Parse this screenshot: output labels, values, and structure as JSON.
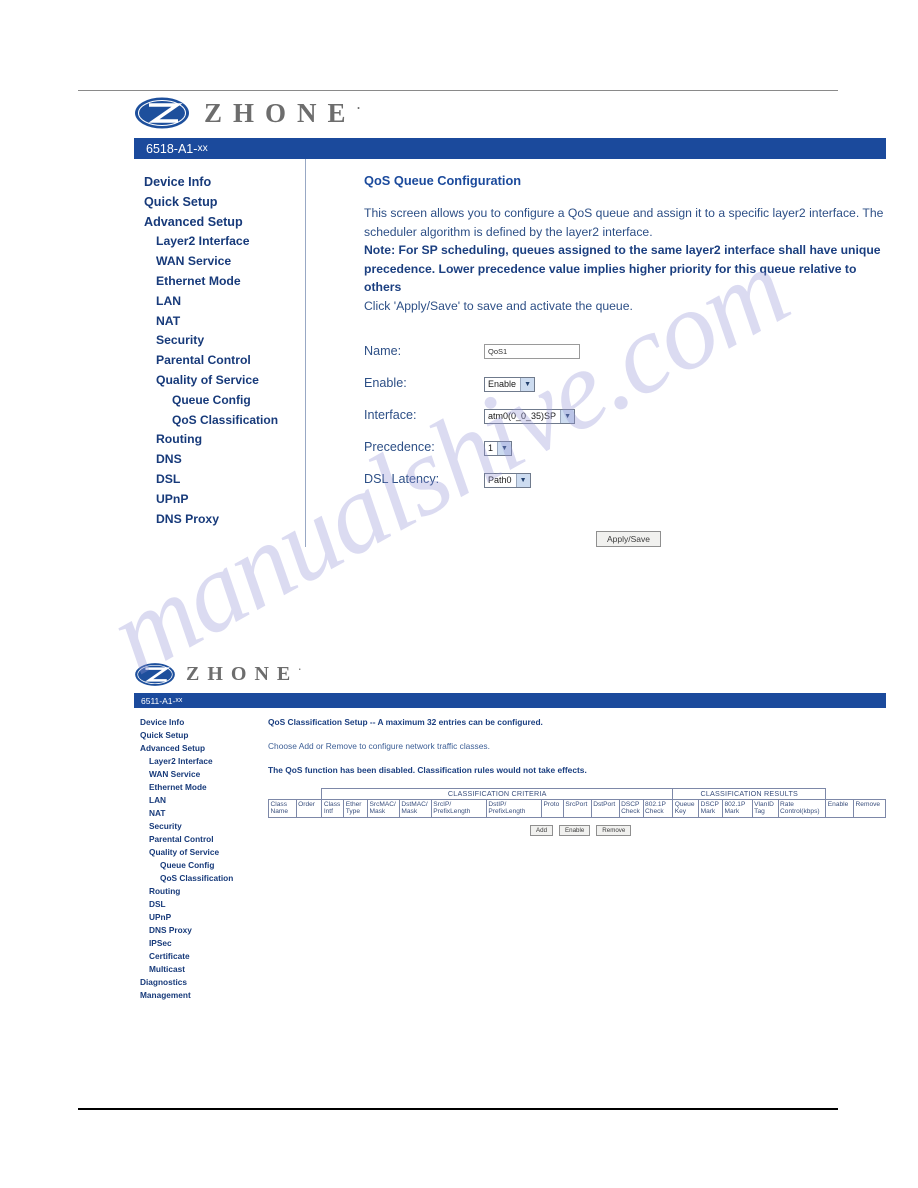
{
  "watermark": {
    "text": "manualshive.com"
  },
  "brand": {
    "wordmark": "ZHONE",
    "tm": "·"
  },
  "screenshot1": {
    "titlebar": {
      "model": "6518-A1-",
      "suffix": "xx"
    },
    "sidebar": {
      "items": [
        {
          "label": "Device Info",
          "level": 1
        },
        {
          "label": "Quick Setup",
          "level": 1
        },
        {
          "label": "Advanced Setup",
          "level": 1
        },
        {
          "label": "Layer2 Interface",
          "level": 2
        },
        {
          "label": "WAN Service",
          "level": 2
        },
        {
          "label": "Ethernet Mode",
          "level": 2
        },
        {
          "label": "LAN",
          "level": 2
        },
        {
          "label": "NAT",
          "level": 2
        },
        {
          "label": "Security",
          "level": 2
        },
        {
          "label": "Parental Control",
          "level": 2
        },
        {
          "label": "Quality of Service",
          "level": 2
        },
        {
          "label": "Queue Config",
          "level": 3
        },
        {
          "label": "QoS Classification",
          "level": 3
        },
        {
          "label": "Routing",
          "level": 2
        },
        {
          "label": "DNS",
          "level": 2
        },
        {
          "label": "DSL",
          "level": 2
        },
        {
          "label": "UPnP",
          "level": 2
        },
        {
          "label": "DNS Proxy",
          "level": 2
        }
      ]
    },
    "content": {
      "heading": "QoS Queue Configuration",
      "intro_line1": "This screen allows you to configure a QoS queue and assign it to a specific layer2 interface. The",
      "intro_line2": "scheduler algorithm is defined by the layer2 interface.",
      "note_label": "Note",
      "note_line1": ": For SP scheduling, queues assigned to the same layer2 interface shall have unique",
      "note_line2": "precedence. Lower precedence value implies higher priority for this queue relative to others",
      "intro_line3": "Click 'Apply/Save' to save and activate the queue.",
      "fields": [
        {
          "label": "Name:",
          "type": "text",
          "value": "QoS1"
        },
        {
          "label": "Enable:",
          "type": "select",
          "value": "Enable"
        },
        {
          "label": "Interface:",
          "type": "select",
          "value": "atm0(0_0_35)SP"
        },
        {
          "label": "Precedence:",
          "type": "select",
          "value": "1"
        },
        {
          "label": "DSL Latency:",
          "type": "select",
          "value": "Path0"
        }
      ],
      "apply_button": "Apply/Save"
    }
  },
  "screenshot2": {
    "titlebar": {
      "model": "6511-A1-",
      "suffix": "xx"
    },
    "sidebar": {
      "items": [
        {
          "label": "Device Info",
          "level": 1
        },
        {
          "label": "Quick Setup",
          "level": 1
        },
        {
          "label": "Advanced Setup",
          "level": 1
        },
        {
          "label": "Layer2 Interface",
          "level": 2
        },
        {
          "label": "WAN Service",
          "level": 2
        },
        {
          "label": "Ethernet Mode",
          "level": 2
        },
        {
          "label": "LAN",
          "level": 2
        },
        {
          "label": "NAT",
          "level": 2
        },
        {
          "label": "Security",
          "level": 2
        },
        {
          "label": "Parental Control",
          "level": 2
        },
        {
          "label": "Quality of Service",
          "level": 2
        },
        {
          "label": "Queue Config",
          "level": 3
        },
        {
          "label": "QoS Classification",
          "level": 3
        },
        {
          "label": "Routing",
          "level": 2
        },
        {
          "label": "DSL",
          "level": 2
        },
        {
          "label": "UPnP",
          "level": 2
        },
        {
          "label": "DNS Proxy",
          "level": 2
        },
        {
          "label": "IPSec",
          "level": 2
        },
        {
          "label": "Certificate",
          "level": 2
        },
        {
          "label": "Multicast",
          "level": 2
        },
        {
          "label": "Diagnostics",
          "level": 1
        },
        {
          "label": "Management",
          "level": 1
        }
      ]
    },
    "content": {
      "heading": "QoS Classification Setup -- A maximum 32 entries can be configured.",
      "subtext": "Choose Add or Remove to configure network traffic classes.",
      "warning": "The QoS function has been disabled.  Classification rules would not take effects.",
      "table": {
        "group_criteria": "CLASSIFICATION CRITERIA",
        "group_results": "CLASSIFICATION RESULTS",
        "columns": [
          "Class Name",
          "Order",
          "Class Intf",
          "Ether Type",
          "SrcMAC/ Mask",
          "DstMAC/ Mask",
          "SrcIP/ PrefixLength",
          "DstIP/ PrefixLength",
          "Proto",
          "SrcPort",
          "DstPort",
          "DSCP Check",
          "802.1P Check",
          "Queue Key",
          "DSCP Mark",
          "802.1P Mark",
          "VlanID Tag",
          "Rate Control(kbps)",
          "Enable",
          "Remove"
        ]
      },
      "buttons": [
        "Add",
        "Enable",
        "Remove"
      ]
    }
  }
}
